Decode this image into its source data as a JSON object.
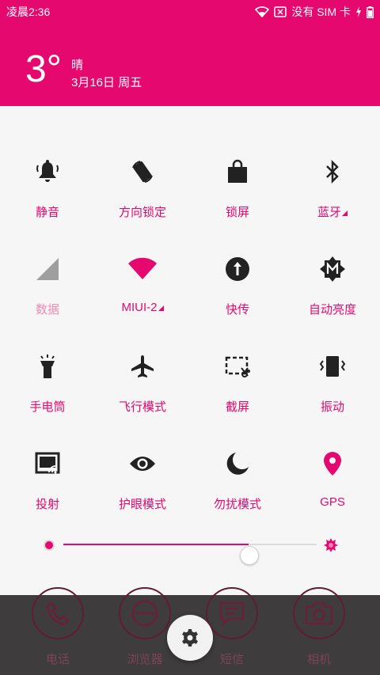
{
  "status_bar": {
    "time": "凌晨2:36",
    "carrier": "没有 SIM 卡"
  },
  "weather": {
    "temperature": "3°",
    "condition": "晴",
    "date": "3月16日 周五"
  },
  "colors": {
    "accent": "#e5086f",
    "dock_bg": "#3f3c3d",
    "panel_bg": "#f6f6f6"
  },
  "toggles": [
    {
      "label": "静音",
      "icon": "bell-icon",
      "active": false,
      "has_more": false
    },
    {
      "label": "方向锁定",
      "icon": "rotation-lock-icon",
      "active": false,
      "has_more": false
    },
    {
      "label": "锁屏",
      "icon": "lock-bag-icon",
      "active": false,
      "has_more": false
    },
    {
      "label": "蓝牙",
      "icon": "bluetooth-icon",
      "active": false,
      "has_more": true
    },
    {
      "label": "数据",
      "icon": "signal-icon",
      "active": false,
      "disabled": true,
      "has_more": false
    },
    {
      "label": "MIUI-2",
      "icon": "wifi-icon",
      "active": true,
      "has_more": true
    },
    {
      "label": "快传",
      "icon": "upload-icon",
      "active": false,
      "has_more": false
    },
    {
      "label": "自动亮度",
      "icon": "auto-brightness-icon",
      "active": false,
      "has_more": false
    },
    {
      "label": "手电筒",
      "icon": "flashlight-icon",
      "active": false,
      "has_more": false
    },
    {
      "label": "飞行模式",
      "icon": "airplane-icon",
      "active": false,
      "has_more": false
    },
    {
      "label": "截屏",
      "icon": "screenshot-icon",
      "active": false,
      "has_more": false
    },
    {
      "label": "振动",
      "icon": "vibrate-icon",
      "active": false,
      "has_more": false
    },
    {
      "label": "投射",
      "icon": "cast-icon",
      "active": false,
      "has_more": false
    },
    {
      "label": "护眼模式",
      "icon": "eye-icon",
      "active": false,
      "has_more": false
    },
    {
      "label": "勿扰模式",
      "icon": "moon-icon",
      "active": false,
      "has_more": false
    },
    {
      "label": "GPS",
      "icon": "location-icon",
      "active": true,
      "has_more": false
    }
  ],
  "brightness": {
    "level": 0.73
  },
  "dock": {
    "apps": [
      {
        "label": "电话",
        "icon": "phone-icon"
      },
      {
        "label": "浏览器",
        "icon": "browser-icon"
      },
      {
        "label": "短信",
        "icon": "message-icon"
      },
      {
        "label": "相机",
        "icon": "camera-icon"
      }
    ],
    "settings_icon": "gear-icon"
  }
}
